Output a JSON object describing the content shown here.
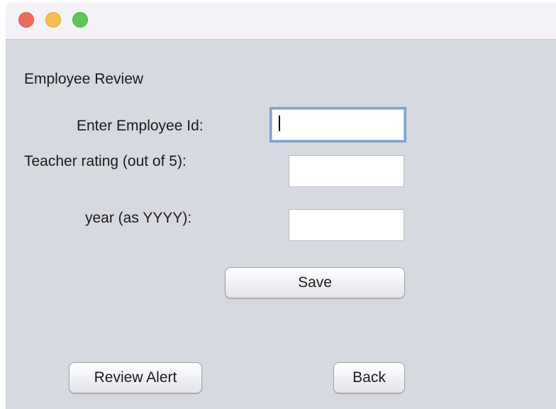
{
  "window": {
    "title": "",
    "controls": {
      "close_color": "#ee6a5f",
      "minimize_color": "#f5bf4f",
      "maximize_color": "#61c554"
    }
  },
  "form": {
    "heading": "Employee Review",
    "employee_id": {
      "label": "Enter Employee Id:",
      "value": ""
    },
    "rating": {
      "label": "Teacher rating (out of 5):",
      "value": ""
    },
    "year": {
      "label": "year (as YYYY):",
      "value": ""
    },
    "save_label": "Save"
  },
  "footer": {
    "review_alert_label": "Review Alert",
    "back_label": "Back"
  },
  "colors": {
    "panel_background": "#d6d9df",
    "focus_ring": "#7ea3cf"
  }
}
